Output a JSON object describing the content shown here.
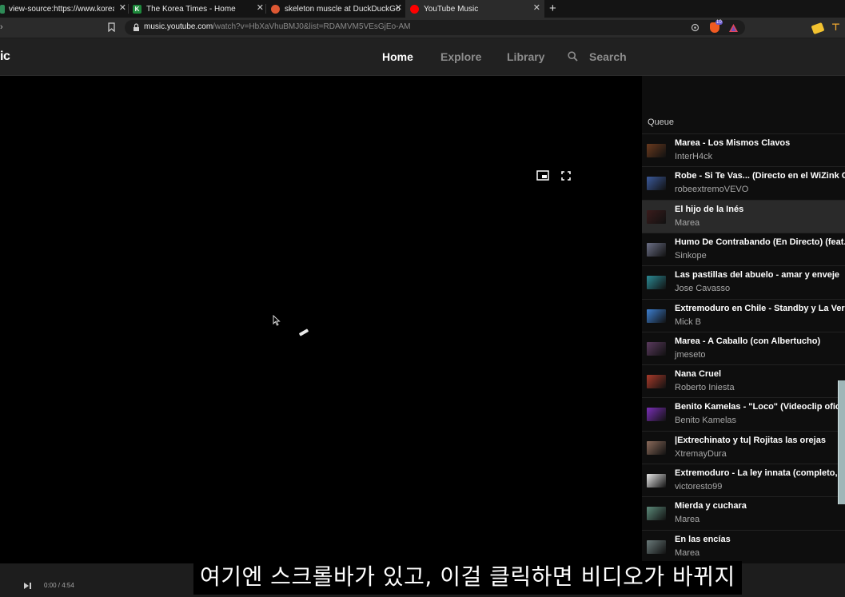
{
  "browser": {
    "tabs": [
      {
        "title": "view-source:https://www.koreati",
        "favicon": "page-icon"
      },
      {
        "title": "The Korea Times - Home",
        "favicon": "korea-times-icon"
      },
      {
        "title": "skeleton muscle at DuckDuckGo",
        "favicon": "duckduckgo-icon"
      },
      {
        "title": "YouTube Music",
        "favicon": "youtube-music-icon"
      }
    ],
    "new_tab": "+",
    "close_glyph": "✕",
    "url_host": "music.youtube.com",
    "url_rest": "/watch?v=HbXaVhuBMJ0&list=RDAMVM5VEsGjEo-AM",
    "brave_badge": "10"
  },
  "app": {
    "logo_text": "ic",
    "nav": {
      "home": "Home",
      "explore": "Explore",
      "library": "Library",
      "search": "Search"
    }
  },
  "queue": {
    "title": "Queue",
    "items": [
      {
        "title": "Marea - Los Mismos Clavos",
        "artist": "InterH4ck",
        "thumb": "#6a3a1e"
      },
      {
        "title": "Robe - Si Te Vas... (Directo en el WiZink C",
        "artist": "robeextremoVEVO",
        "thumb": "#3b5a9c"
      },
      {
        "title": "El hijo de la Inés",
        "artist": "Marea",
        "thumb": "#3a1c1c"
      },
      {
        "title": "Humo De Contrabando (En Directo) (feat.",
        "artist": "Sinkope",
        "thumb": "#6b6f86"
      },
      {
        "title": "Las pastillas del abuelo - amar y enveje",
        "artist": "Jose Cavasso",
        "thumb": "#2b8a94"
      },
      {
        "title": "Extremoduro en Chile - Standby y La Vere",
        "artist": "Mick B",
        "thumb": "#3d7fd0"
      },
      {
        "title": "Marea - A Caballo (con Albertucho)",
        "artist": "jmeseto",
        "thumb": "#5a3a5e"
      },
      {
        "title": "Nana Cruel",
        "artist": "Roberto Iniesta",
        "thumb": "#a83a2a"
      },
      {
        "title": "Benito Kamelas - \"Loco\" (Videoclip ofici",
        "artist": "Benito Kamelas",
        "thumb": "#7a2fb8"
      },
      {
        "title": "|Extrechinato y tu| Rojitas las orejas",
        "artist": "XtremayDura",
        "thumb": "#8a6a5a"
      },
      {
        "title": "Extremoduro - La ley innata (completo,",
        "artist": "victoresto99",
        "thumb": "#e8e8e8"
      },
      {
        "title": "Mierda y cuchara",
        "artist": "Marea",
        "thumb": "#5c8a7a"
      },
      {
        "title": "En las encías",
        "artist": "Marea",
        "thumb": "#6a7a7a"
      }
    ]
  },
  "player": {
    "time": "0:00 / 4:54"
  },
  "subtitle": "여기엔 스크롤바가 있고, 이걸 클릭하면 비디오가 바뀌지"
}
